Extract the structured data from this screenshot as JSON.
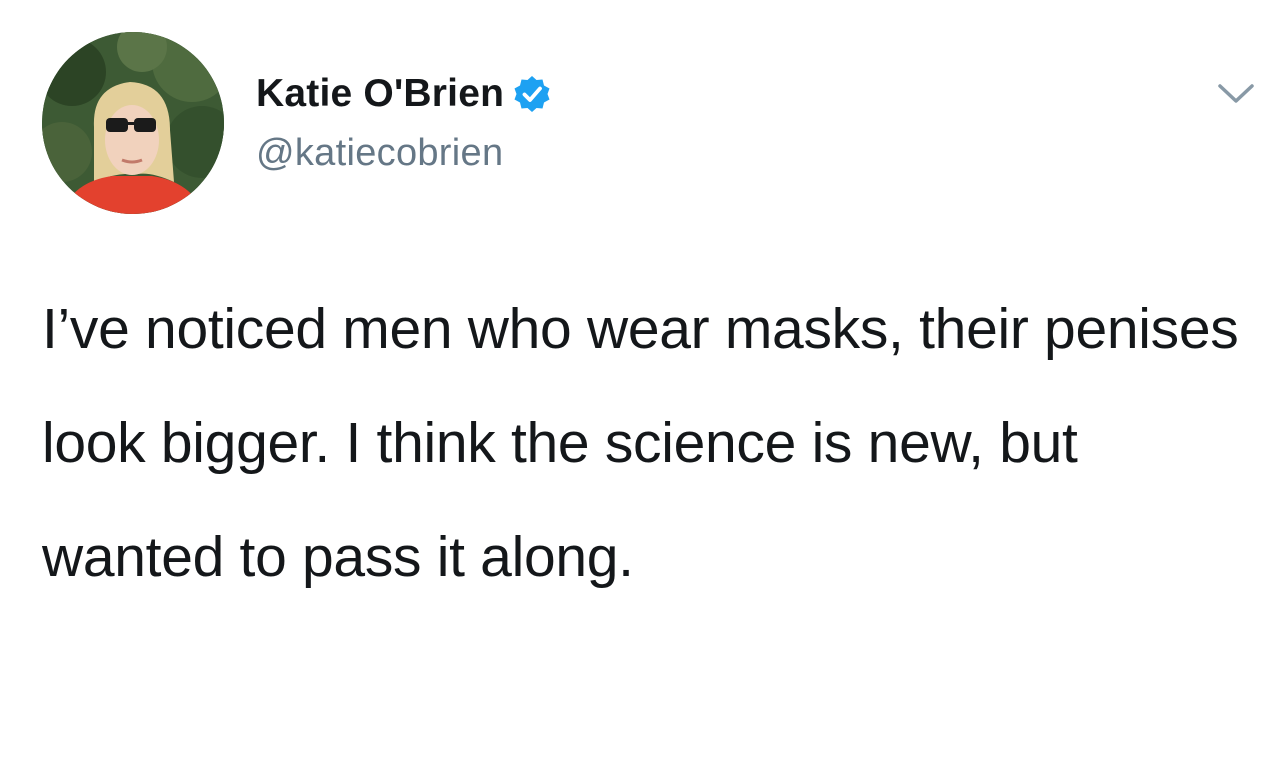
{
  "tweet": {
    "author": {
      "display_name": "Katie O'Brien",
      "handle": "@katiecobrien",
      "verified": true
    },
    "text": "I’ve noticed men who wear masks, their penises look bigger. I think the science is new, but wanted to pass it along.",
    "icons": {
      "verified": "verified-badge-icon",
      "menu": "chevron-down-icon"
    },
    "colors": {
      "verified_badge": "#1da1f2",
      "handle": "#657786",
      "text": "#14171a"
    }
  }
}
